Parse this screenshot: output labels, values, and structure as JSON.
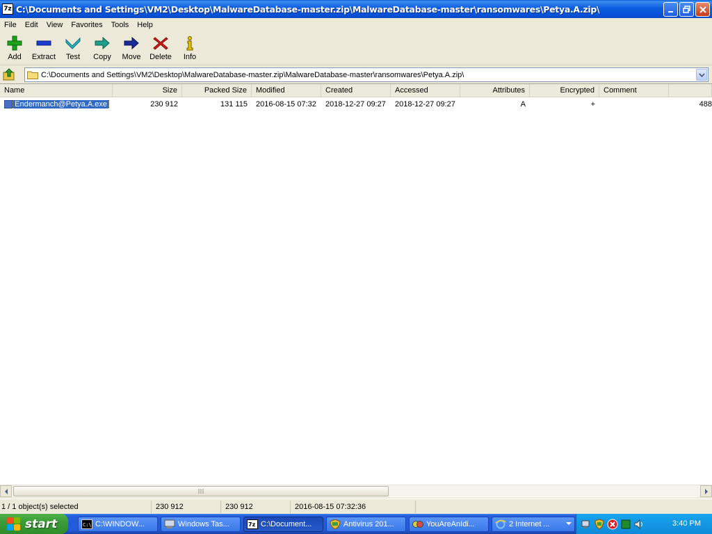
{
  "window": {
    "app_icon_text": "7z",
    "title": "C:\\Documents and Settings\\VM2\\Desktop\\MalwareDatabase-master.zip\\MalwareDatabase-master\\ransomwares\\Petya.A.zip\\"
  },
  "menu": [
    "File",
    "Edit",
    "View",
    "Favorites",
    "Tools",
    "Help"
  ],
  "toolbar": [
    {
      "label": "Add",
      "icon": "plus-icon"
    },
    {
      "label": "Extract",
      "icon": "minus-icon"
    },
    {
      "label": "Test",
      "icon": "check-icon"
    },
    {
      "label": "Copy",
      "icon": "copy-arrow-icon"
    },
    {
      "label": "Move",
      "icon": "move-arrow-icon"
    },
    {
      "label": "Delete",
      "icon": "delete-x-icon"
    },
    {
      "label": "Info",
      "icon": "info-icon"
    }
  ],
  "address": {
    "path": "C:\\Documents and Settings\\VM2\\Desktop\\MalwareDatabase-master.zip\\MalwareDatabase-master\\ransomwares\\Petya.A.zip\\"
  },
  "columns": [
    "Name",
    "Size",
    "Packed Size",
    "Modified",
    "Created",
    "Accessed",
    "Attributes",
    "Encrypted",
    "Comment",
    ""
  ],
  "files": [
    {
      "name": "Endermanch@Petya.A.exe",
      "size": "230 912",
      "packed_size": "131 115",
      "modified": "2016-08-15 07:32",
      "created": "2018-12-27 09:27",
      "accessed": "2018-12-27 09:27",
      "attributes": "A",
      "encrypted": "+",
      "comment": "",
      "extra": "488"
    }
  ],
  "status": {
    "selection": "1 / 1 object(s) selected",
    "size": "230 912",
    "packed": "230 912",
    "modified": "2016-08-15 07:32:36"
  },
  "taskbar": {
    "start_label": "start",
    "tasks": [
      {
        "label": "C:\\WINDOW...",
        "icon": "console-icon",
        "active": false
      },
      {
        "label": "Windows Tas...",
        "icon": "task-manager-icon",
        "active": false
      },
      {
        "label": "C:\\Document...",
        "icon": "7zip-icon",
        "active": true
      },
      {
        "label": "Antivirus 201...",
        "icon": "shield-icon",
        "active": false
      },
      {
        "label": "YouAreAnIdi...",
        "icon": "smiley-icon",
        "active": false
      },
      {
        "label": "2 Internet ...",
        "icon": "internet-explorer-icon",
        "active": false
      }
    ],
    "clock": "3:40 PM"
  }
}
